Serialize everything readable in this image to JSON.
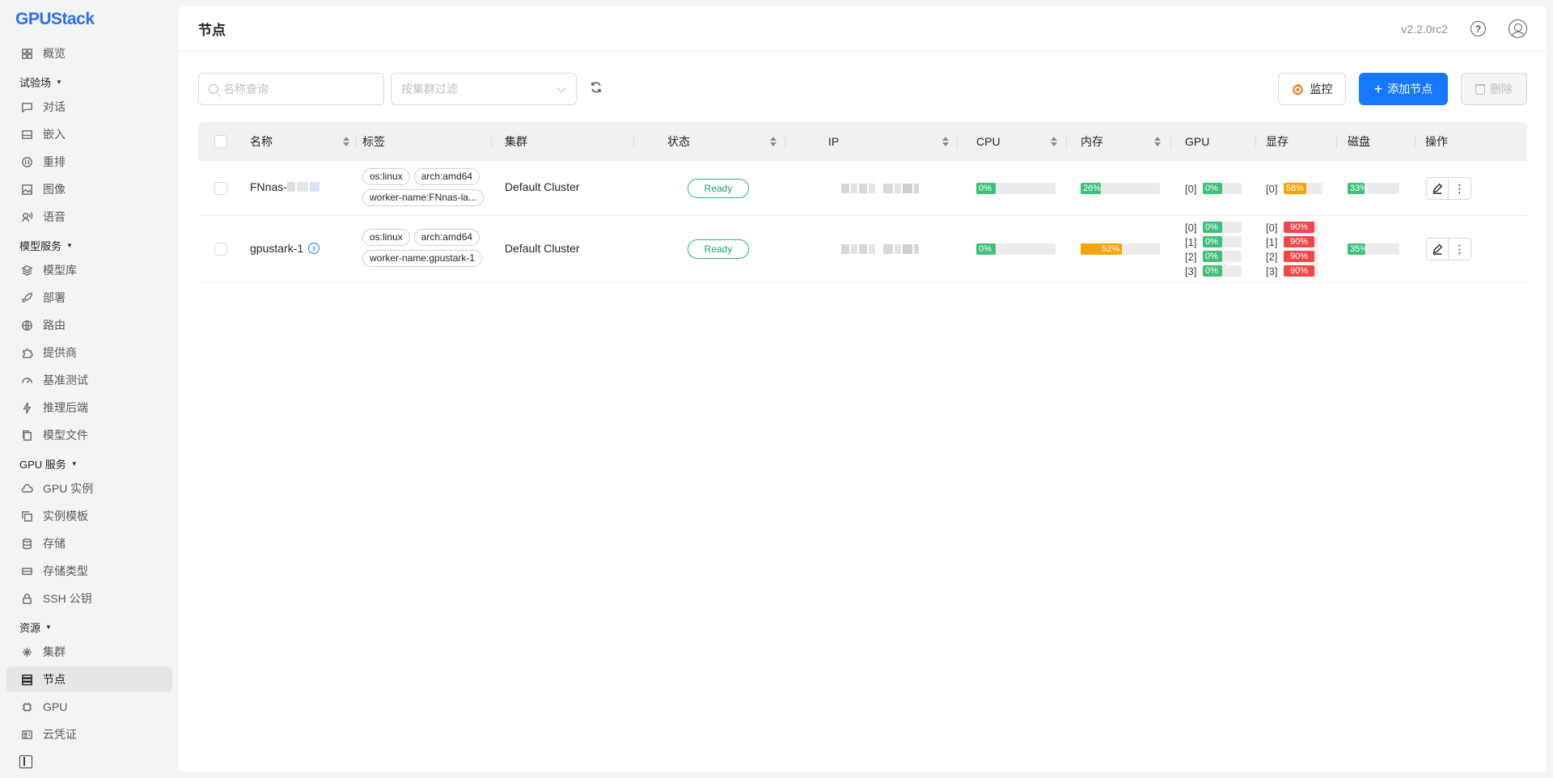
{
  "app": {
    "logo_text": "GPUStack"
  },
  "sidebar": {
    "items_top": [
      {
        "label": "概览",
        "icon": "dashboard-icon"
      }
    ],
    "groups": [
      {
        "title": "试验场",
        "items": [
          {
            "label": "对话",
            "icon": "chat-icon"
          },
          {
            "label": "嵌入",
            "icon": "embed-icon"
          },
          {
            "label": "重排",
            "icon": "rerank-icon"
          },
          {
            "label": "图像",
            "icon": "image-icon"
          },
          {
            "label": "语音",
            "icon": "audio-icon"
          }
        ]
      },
      {
        "title": "模型服务",
        "items": [
          {
            "label": "模型库",
            "icon": "layers-icon"
          },
          {
            "label": "部署",
            "icon": "rocket-icon"
          },
          {
            "label": "路由",
            "icon": "globe-icon"
          },
          {
            "label": "提供商",
            "icon": "puzzle-icon"
          },
          {
            "label": "基准测试",
            "icon": "gauge-icon"
          },
          {
            "label": "推理后端",
            "icon": "bolt-icon"
          },
          {
            "label": "模型文件",
            "icon": "files-icon"
          }
        ]
      },
      {
        "title": "GPU 服务",
        "items": [
          {
            "label": "GPU 实例",
            "icon": "cloud-icon"
          },
          {
            "label": "实例模板",
            "icon": "copy-icon"
          },
          {
            "label": "存储",
            "icon": "database-icon"
          },
          {
            "label": "存储类型",
            "icon": "drive-icon"
          },
          {
            "label": "SSH 公钥",
            "icon": "lock-icon"
          }
        ]
      },
      {
        "title": "资源",
        "items": [
          {
            "label": "集群",
            "icon": "cluster-icon"
          },
          {
            "label": "节点",
            "icon": "server-icon",
            "active": true
          },
          {
            "label": "GPU",
            "icon": "chip-icon"
          },
          {
            "label": "云凭证",
            "icon": "id-card-icon"
          }
        ]
      }
    ]
  },
  "header": {
    "title": "节点",
    "version": "v2.2.0rc2"
  },
  "toolbar": {
    "search_placeholder": "名称查询",
    "cluster_filter_placeholder": "按集群过滤",
    "monitor_label": "监控",
    "add_label": "添加节点",
    "delete_label": "删除"
  },
  "table": {
    "columns": [
      "名称",
      "标签",
      "集群",
      "状态",
      "IP",
      "CPU",
      "内存",
      "GPU",
      "显存",
      "磁盘",
      "操作"
    ],
    "rows": [
      {
        "name": "FNnas-",
        "labels": [
          "os:linux",
          "arch:amd64",
          "worker-name:FNnas-la..."
        ],
        "cluster": "Default Cluster",
        "status": "Ready",
        "cpu": {
          "value": 0,
          "text": "0%"
        },
        "memory": {
          "value": 26,
          "text": "26%",
          "color": "#3fc07a"
        },
        "gpus": [
          {
            "idx": "[0]",
            "util": "0%"
          }
        ],
        "vram": [
          {
            "idx": "[0]",
            "value": 58,
            "text": "58%",
            "color": "#f5a30c"
          }
        ],
        "disk": {
          "value": 33,
          "text": "33%"
        }
      },
      {
        "name": "gpustark-1",
        "labels": [
          "os:linux",
          "arch:amd64",
          "worker-name:gpustark-1"
        ],
        "cluster": "Default Cluster",
        "status": "Ready",
        "cpu": {
          "value": 0,
          "text": "0%"
        },
        "memory": {
          "value": 52,
          "text": "52%",
          "color": "#f5a30c"
        },
        "gpus": [
          {
            "idx": "[0]",
            "util": "0%"
          },
          {
            "idx": "[1]",
            "util": "0%"
          },
          {
            "idx": "[2]",
            "util": "0%"
          },
          {
            "idx": "[3]",
            "util": "0%"
          }
        ],
        "vram": [
          {
            "idx": "[0]",
            "value": 90,
            "text": "90%",
            "color": "#f04848"
          },
          {
            "idx": "[1]",
            "value": 90,
            "text": "90%",
            "color": "#f04848"
          },
          {
            "idx": "[2]",
            "value": 90,
            "text": "90%",
            "color": "#f04848"
          },
          {
            "idx": "[3]",
            "value": 90,
            "text": "90%",
            "color": "#f04848"
          }
        ],
        "disk": {
          "value": 35,
          "text": "35%"
        }
      }
    ]
  },
  "colors": {
    "accent": "#1677ff",
    "ok": "#3fc07a",
    "warn": "#f5a30c",
    "danger": "#f04848"
  }
}
